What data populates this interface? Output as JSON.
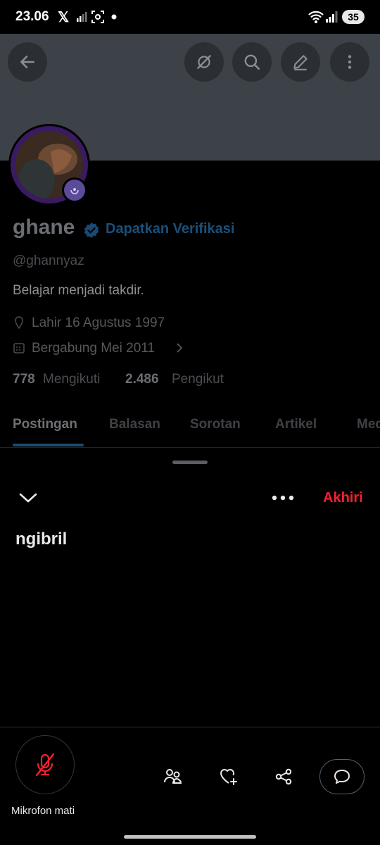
{
  "status_bar": {
    "time": "23.06",
    "x_icon": "𝕏",
    "battery": "35"
  },
  "profile": {
    "name": "ghane",
    "verify_link": "Dapatkan Verifikasi",
    "handle": "@ghannyaz",
    "bio": "Belajar menjadi takdir.",
    "birth": "Lahir 16 Agustus 1997",
    "joined": "Bergabung Mei 2011",
    "following_count": "778",
    "following_label": "Mengikuti",
    "followers_count": "2.486",
    "followers_label": "Pengikut"
  },
  "tabs": [
    "Postingan",
    "Balasan",
    "Sorotan",
    "Artikel",
    "Media"
  ],
  "space": {
    "title": "ngibril",
    "end_label": "Akhiri",
    "mic_label": "Mikrofon mati"
  },
  "colors": {
    "accent_red": "#f4212e",
    "verify_blue": "#1d9bf0"
  }
}
